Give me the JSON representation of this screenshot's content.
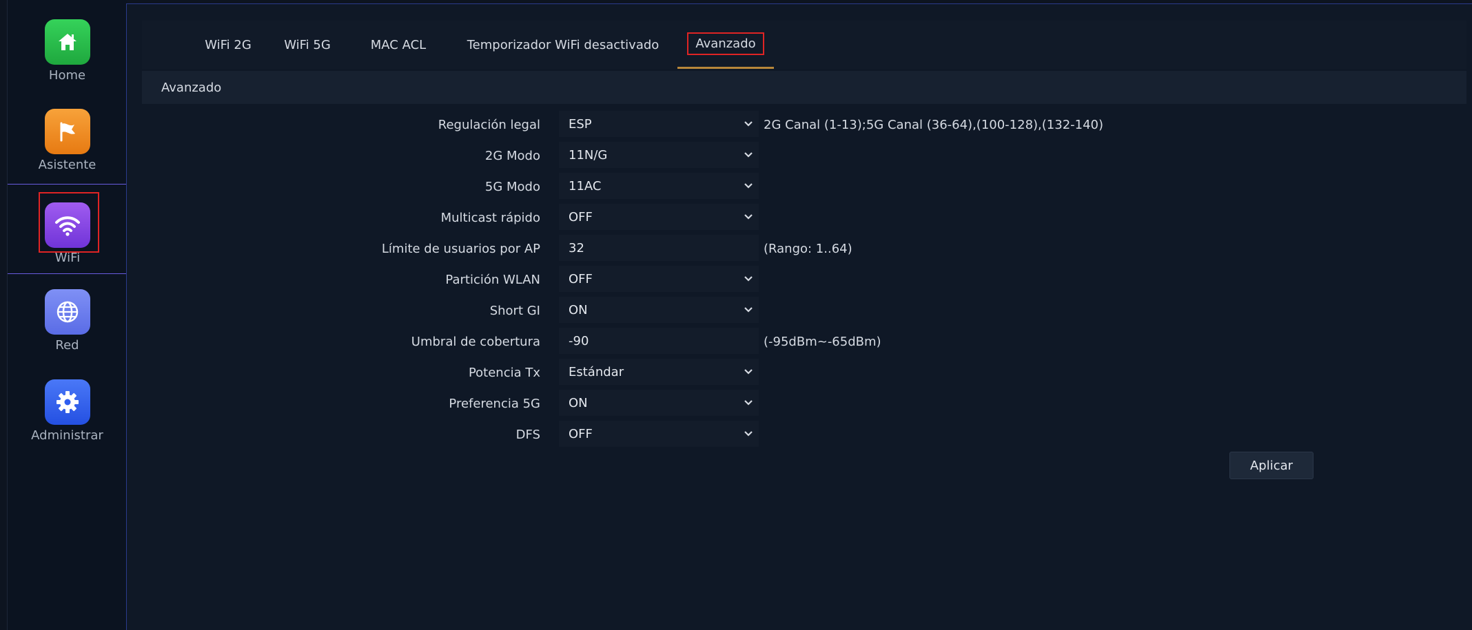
{
  "sidebar": {
    "items": [
      {
        "label": "Home",
        "icon": "home-icon",
        "color": "#27c24c"
      },
      {
        "label": "Asistente",
        "icon": "flag-icon",
        "color": "#f08a1c"
      },
      {
        "label": "WiFi",
        "icon": "wifi-icon",
        "color": "#8a4fe0"
      },
      {
        "label": "Red",
        "icon": "globe-icon",
        "color": "#6a7ef0"
      },
      {
        "label": "Administrar",
        "icon": "gear-icon",
        "color": "#2f5ef0"
      }
    ],
    "active_index": 2
  },
  "tabs": [
    {
      "label": "WiFi 2G"
    },
    {
      "label": "WiFi 5G"
    },
    {
      "label": "MAC ACL"
    },
    {
      "label": "Temporizador WiFi desactivado"
    },
    {
      "label": "Avanzado",
      "active": true
    }
  ],
  "section": {
    "title": "Avanzado"
  },
  "form": {
    "rows": [
      {
        "label": "Regulación legal",
        "value": "ESP",
        "type": "select",
        "hint": "2G Canal (1-13);5G Canal (36-64),(100-128),(132-140)"
      },
      {
        "label": "2G Modo",
        "value": "11N/G",
        "type": "select",
        "hint": ""
      },
      {
        "label": "5G Modo",
        "value": "11AC",
        "type": "select",
        "hint": ""
      },
      {
        "label": "Multicast rápido",
        "value": "OFF",
        "type": "select",
        "hint": ""
      },
      {
        "label": "Límite de usuarios por AP",
        "value": "32",
        "type": "input",
        "hint": "(Rango: 1..64)"
      },
      {
        "label": "Partición WLAN",
        "value": "OFF",
        "type": "select",
        "hint": ""
      },
      {
        "label": "Short GI",
        "value": "ON",
        "type": "select",
        "hint": ""
      },
      {
        "label": "Umbral de cobertura",
        "value": "-90",
        "type": "input",
        "hint": "(-95dBm~-65dBm)"
      },
      {
        "label": "Potencia Tx",
        "value": "Estándar",
        "type": "select",
        "hint": ""
      },
      {
        "label": "Preferencia 5G",
        "value": "ON",
        "type": "select",
        "hint": ""
      },
      {
        "label": "DFS",
        "value": "OFF",
        "type": "select",
        "hint": ""
      }
    ]
  },
  "apply_label": "Aplicar",
  "colors": {
    "highlight": "#e02424",
    "tab_underline": "#b8873a",
    "active_border": "#6a5ce0"
  }
}
